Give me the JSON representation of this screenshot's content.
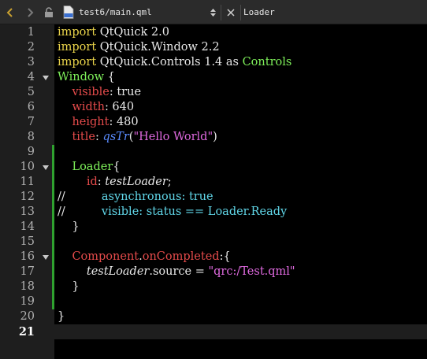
{
  "toolbar": {
    "file_name": "test6/main.qml",
    "file_icon_label": "qml",
    "symbol": "Loader"
  },
  "colors": {
    "keyword": "#e8d24a",
    "type": "#7ef05a",
    "property": "#e54b4b",
    "function": "#5a8cff",
    "string": "#e06ae0",
    "comment_code": "#60d6e8",
    "change_marker": "#2fa12f"
  },
  "editor": {
    "current_line": "21",
    "lines": [
      {
        "num": "1",
        "tokens": [
          {
            "t": "import",
            "c": "kw"
          },
          {
            "t": " QtQuick 2.0",
            "c": ""
          }
        ]
      },
      {
        "num": "2",
        "tokens": [
          {
            "t": "import",
            "c": "kw"
          },
          {
            "t": " QtQuick.Window 2.2",
            "c": ""
          }
        ]
      },
      {
        "num": "3",
        "tokens": [
          {
            "t": "import",
            "c": "kw"
          },
          {
            "t": " QtQuick.Controls 1.4 as ",
            "c": ""
          },
          {
            "t": "Controls",
            "c": "ty"
          }
        ]
      },
      {
        "num": "4",
        "fold": true,
        "tokens": [
          {
            "t": "Window",
            "c": "ty"
          },
          {
            "t": " {",
            "c": ""
          }
        ]
      },
      {
        "num": "5",
        "tokens": [
          {
            "t": "    ",
            "c": ""
          },
          {
            "t": "visible",
            "c": "pr"
          },
          {
            "t": ": true",
            "c": ""
          }
        ]
      },
      {
        "num": "6",
        "tokens": [
          {
            "t": "    ",
            "c": ""
          },
          {
            "t": "width",
            "c": "pr"
          },
          {
            "t": ": 640",
            "c": ""
          }
        ]
      },
      {
        "num": "7",
        "tokens": [
          {
            "t": "    ",
            "c": ""
          },
          {
            "t": "height",
            "c": "pr"
          },
          {
            "t": ": 480",
            "c": ""
          }
        ]
      },
      {
        "num": "8",
        "tokens": [
          {
            "t": "    ",
            "c": ""
          },
          {
            "t": "title",
            "c": "pr"
          },
          {
            "t": ": ",
            "c": ""
          },
          {
            "t": "qsTr",
            "c": "fn"
          },
          {
            "t": "(",
            "c": ""
          },
          {
            "t": "\"Hello World\"",
            "c": "st"
          },
          {
            "t": ")",
            "c": ""
          }
        ]
      },
      {
        "num": "9",
        "mark": true,
        "tokens": []
      },
      {
        "num": "10",
        "fold": true,
        "mark": true,
        "tokens": [
          {
            "t": "    ",
            "c": ""
          },
          {
            "t": "Loader",
            "c": "ty"
          },
          {
            "t": "{",
            "c": ""
          }
        ]
      },
      {
        "num": "11",
        "mark": true,
        "tokens": [
          {
            "t": "        ",
            "c": ""
          },
          {
            "t": "id",
            "c": "pr"
          },
          {
            "t": ": ",
            "c": ""
          },
          {
            "t": "testLoader",
            "c": "it"
          },
          {
            "t": ";",
            "c": ""
          }
        ]
      },
      {
        "num": "12",
        "mark": true,
        "tokens": [
          {
            "t": "//",
            "c": "cm"
          },
          {
            "t": "          asynchronous: true",
            "c": "cmc"
          }
        ]
      },
      {
        "num": "13",
        "mark": true,
        "tokens": [
          {
            "t": "//",
            "c": "cm"
          },
          {
            "t": "          visible: status == Loader.Ready",
            "c": "cmc"
          }
        ]
      },
      {
        "num": "14",
        "mark": true,
        "tokens": [
          {
            "t": "    }",
            "c": ""
          }
        ]
      },
      {
        "num": "15",
        "mark": true,
        "tokens": []
      },
      {
        "num": "16",
        "fold": true,
        "mark": true,
        "tokens": [
          {
            "t": "    ",
            "c": ""
          },
          {
            "t": "Component",
            "c": "pr"
          },
          {
            "t": ".",
            "c": ""
          },
          {
            "t": "onCompleted",
            "c": "pr"
          },
          {
            "t": ":{",
            "c": ""
          }
        ]
      },
      {
        "num": "17",
        "mark": true,
        "tokens": [
          {
            "t": "        ",
            "c": ""
          },
          {
            "t": "testLoader",
            "c": "it"
          },
          {
            "t": ".source = ",
            "c": ""
          },
          {
            "t": "\"qrc:/Test.qml\"",
            "c": "st"
          }
        ]
      },
      {
        "num": "18",
        "mark": true,
        "tokens": [
          {
            "t": "    }",
            "c": ""
          }
        ]
      },
      {
        "num": "19",
        "mark": true,
        "tokens": []
      },
      {
        "num": "20",
        "tokens": [
          {
            "t": "}",
            "c": ""
          }
        ]
      },
      {
        "num": "21",
        "tokens": []
      }
    ]
  }
}
